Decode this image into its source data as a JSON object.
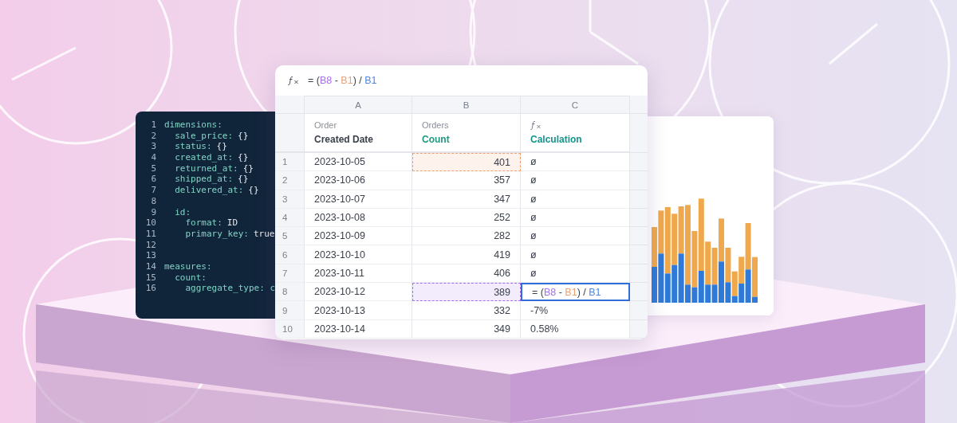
{
  "code_editor": {
    "lines": [
      {
        "number": "1",
        "key": "dimensions:"
      },
      {
        "number": "2",
        "key": "  sale_price:",
        "value": "{}"
      },
      {
        "number": "3",
        "key": "  status:",
        "value": "{}"
      },
      {
        "number": "4",
        "key": "  created_at:",
        "value": "{}"
      },
      {
        "number": "5",
        "key": "  returned_at:",
        "value": "{}"
      },
      {
        "number": "6",
        "key": "  shipped_at:",
        "value": "{}"
      },
      {
        "number": "7",
        "key": "  delivered_at:",
        "value": "{}"
      },
      {
        "number": "8"
      },
      {
        "number": "9",
        "key": "  id:"
      },
      {
        "number": "10",
        "key": "    format:",
        "value": "ID"
      },
      {
        "number": "11",
        "key": "    primary_key:",
        "value": "true"
      },
      {
        "number": "12"
      },
      {
        "number": "13"
      },
      {
        "number": "14",
        "key": "measures:"
      },
      {
        "number": "15",
        "key": "  count:"
      },
      {
        "number": "16",
        "key": "    aggregate_type: c"
      }
    ]
  },
  "spreadsheet": {
    "formula": [
      {
        "text": "= ("
      },
      {
        "text": "B8",
        "color": "#a56ef0"
      },
      {
        "text": " - "
      },
      {
        "text": "B1",
        "color": "#f0a070"
      },
      {
        "text": ") / "
      },
      {
        "text": "B1",
        "color": "#4f86e0"
      }
    ],
    "columns": [
      {
        "letter": "A",
        "kind": "dimension",
        "group": "Order",
        "name": "Created Date"
      },
      {
        "letter": "B",
        "kind": "measure",
        "group": "Orders",
        "name": "Count"
      },
      {
        "letter": "C",
        "kind": "calculation",
        "name": "Calculation"
      }
    ],
    "rows": [
      {
        "number": "1",
        "date": "2023-10-05",
        "count": "401",
        "color": "#f0a070",
        "calc": "ø",
        "editing": false
      },
      {
        "number": "2",
        "date": "2023-10-06",
        "count": "357",
        "calc": "ø",
        "editing": false
      },
      {
        "number": "3",
        "date": "2023-10-07",
        "count": "347",
        "calc": "ø",
        "editing": false
      },
      {
        "number": "4",
        "date": "2023-10-08",
        "count": "252",
        "calc": "ø",
        "editing": false
      },
      {
        "number": "5",
        "date": "2023-10-09",
        "count": "282",
        "calc": "ø",
        "editing": false
      },
      {
        "number": "6",
        "date": "2023-10-10",
        "count": "419",
        "calc": "ø",
        "editing": false
      },
      {
        "number": "7",
        "date": "2023-10-11",
        "count": "406",
        "calc": "ø",
        "editing": false
      },
      {
        "number": "8",
        "date": "2023-10-12",
        "count": "389",
        "color": "#a56ef0",
        "calc_formula": [
          {
            "text": "= ("
          },
          {
            "text": "B8",
            "color": "#a56ef0"
          },
          {
            "text": " - "
          },
          {
            "text": "B1",
            "color": "#f0a070"
          },
          {
            "text": ") / "
          },
          {
            "text": "B1",
            "color": "#4f86e0"
          }
        ],
        "editing": true
      },
      {
        "number": "9",
        "date": "2023-10-13",
        "count": "332",
        "calc": "-7%",
        "editing": false
      },
      {
        "number": "10",
        "date": "2023-10-14",
        "count": "349",
        "calc": "0.58%",
        "editing": false
      }
    ]
  }
}
